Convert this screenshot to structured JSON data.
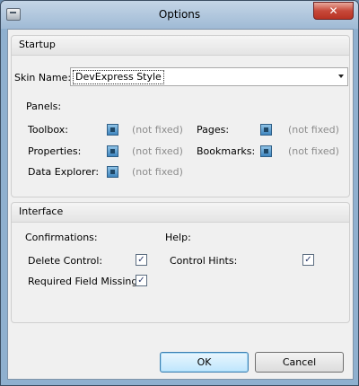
{
  "window": {
    "title": "Options",
    "close_glyph": "✕"
  },
  "startup": {
    "header": "Startup",
    "skin_label": "Skin Name:",
    "skin_value": "DevExpress Style",
    "panels_label": "Panels:",
    "panels": [
      {
        "label": "Toolbox:",
        "state": "(not fixed)"
      },
      {
        "label": "Properties:",
        "state": "(not fixed)"
      },
      {
        "label": "Data Explorer:",
        "state": "(not fixed)"
      },
      {
        "label": "Pages:",
        "state": "(not fixed)"
      },
      {
        "label": "Bookmarks:",
        "state": "(not fixed)"
      }
    ]
  },
  "interface": {
    "header": "Interface",
    "confirmations_label": "Confirmations:",
    "help_label": "Help:",
    "options": [
      {
        "label": "Delete Control:",
        "checked": true
      },
      {
        "label": "Required Field Missing:",
        "checked": true
      },
      {
        "label": "Control Hints:",
        "checked": true
      }
    ],
    "check_glyph": "✓"
  },
  "buttons": {
    "ok": "OK",
    "cancel": "Cancel"
  }
}
